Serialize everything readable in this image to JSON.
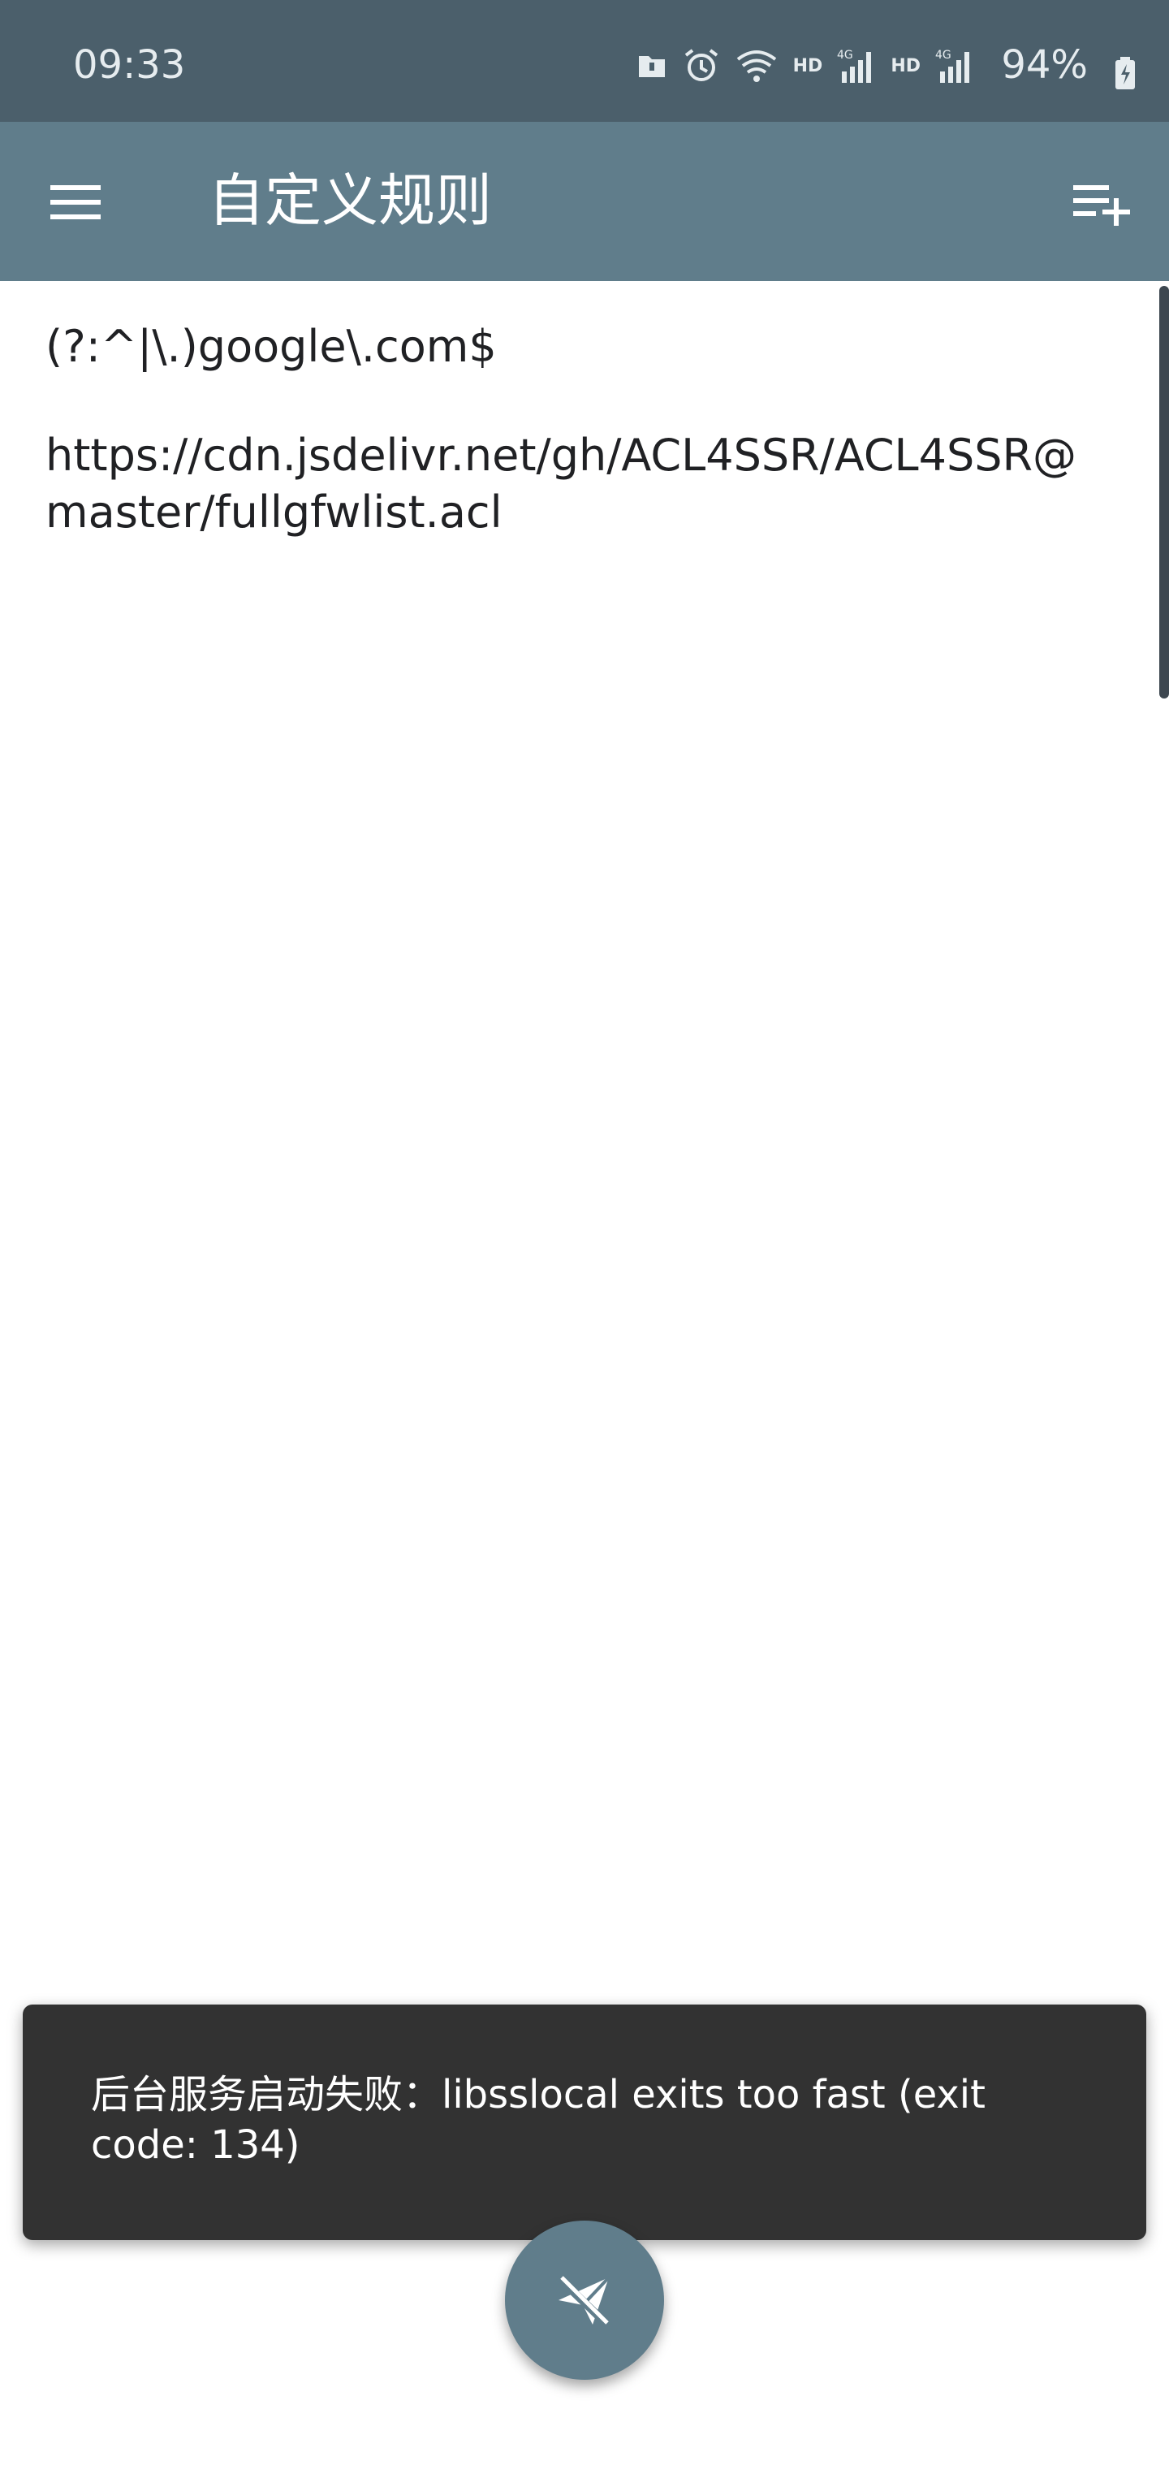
{
  "status_bar": {
    "time": "09:33",
    "icons": [
      "sd-card-icon",
      "alarm-icon",
      "wifi-icon",
      "signal-icon",
      "signal-icon",
      "battery-charging-icon"
    ],
    "network_badge_1": "HD",
    "network_badge_2": "HD",
    "network_type": "4G",
    "battery_level": "94%"
  },
  "app_bar": {
    "title": "自定义规则",
    "menu_icon": "menu-icon",
    "add_icon": "playlist-add-icon"
  },
  "rules": [
    "(?:^|\\.)google\\.com$",
    "https://cdn.jsdelivr.net/gh/ACL4SSR/ACL4SSR@master/fullgfwlist.acl"
  ],
  "snackbar": {
    "message": "后台服务启动失败：libsslocal exits too fast (exit code: 134)"
  },
  "fab": {
    "icon": "paper-plane-off-icon"
  },
  "colors": {
    "status_bar": "#4b5f6b",
    "app_bar": "#607d8b",
    "snackbar": "#323232",
    "fab": "#607d8b"
  }
}
